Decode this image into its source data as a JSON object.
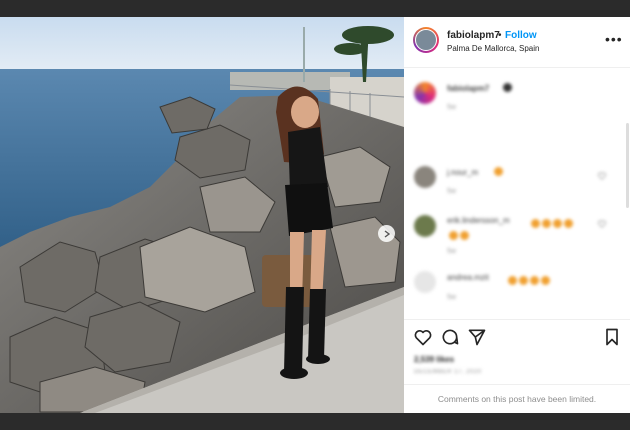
{
  "post": {
    "username": "fabiolapm7",
    "separator": "•",
    "follow_label": "Follow",
    "location": "Palma De Mallorca, Spain",
    "more_label": "•••"
  },
  "comments": [
    {
      "name": "fabiolapm7",
      "meta": "5w",
      "emojis": 0
    },
    {
      "name": "j.nour_m",
      "meta": "5w",
      "emojis": 1
    },
    {
      "name": "erik.lindersson_m",
      "meta": "5w",
      "emojis": 6
    },
    {
      "name": "andrea.mzit",
      "meta": "5w",
      "emojis": 4
    }
  ],
  "stats": {
    "likes": "2,539 likes",
    "date": "DECEMBER 17, 2020"
  },
  "footer": {
    "limited_text": "Comments on this post have been limited."
  },
  "icons": {
    "like": "heart-icon",
    "comment": "comment-icon",
    "share": "share-icon",
    "save": "bookmark-icon",
    "next": "chevron-right-icon"
  },
  "colors": {
    "link": "#0095f6",
    "carousel_active": "#3897f0"
  }
}
